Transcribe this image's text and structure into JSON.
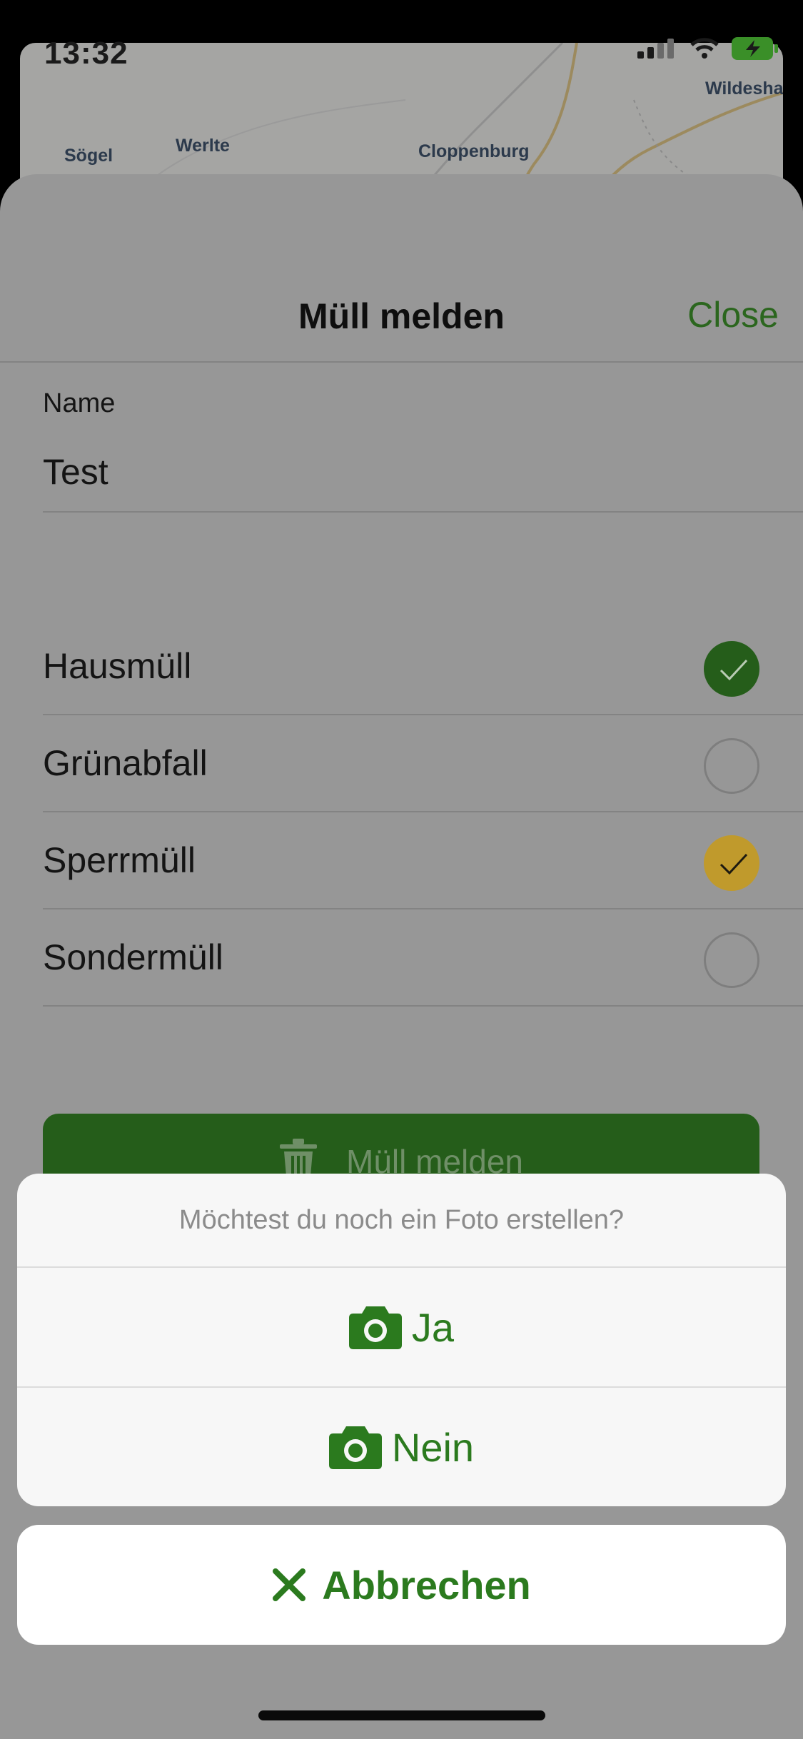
{
  "status_bar": {
    "time": "13:32"
  },
  "map": {
    "labels": [
      "Sögel",
      "Werlte",
      "Cloppenburg",
      "Wildesha"
    ]
  },
  "sheet": {
    "title": "Müll melden",
    "close_label": "Close"
  },
  "form": {
    "name_label": "Name",
    "name_value": "Test",
    "options": [
      {
        "label": "Hausmüll",
        "checked": true,
        "color": "#255d1a"
      },
      {
        "label": "Grünabfall",
        "checked": false
      },
      {
        "label": "Sperrmüll",
        "checked": true,
        "color": "#c09a2c"
      },
      {
        "label": "Sondermüll",
        "checked": false
      }
    ],
    "submit_label": "Müll melden",
    "submit_icon": "trash-icon"
  },
  "action_sheet": {
    "title": "Möchtest du noch ein Foto erstellen?",
    "yes_label": "Ja",
    "no_label": "Nein",
    "option_icon": "camera-icon",
    "cancel_label": "Abbrechen",
    "cancel_icon": "close-icon",
    "accent_color": "#2b7a1e"
  }
}
